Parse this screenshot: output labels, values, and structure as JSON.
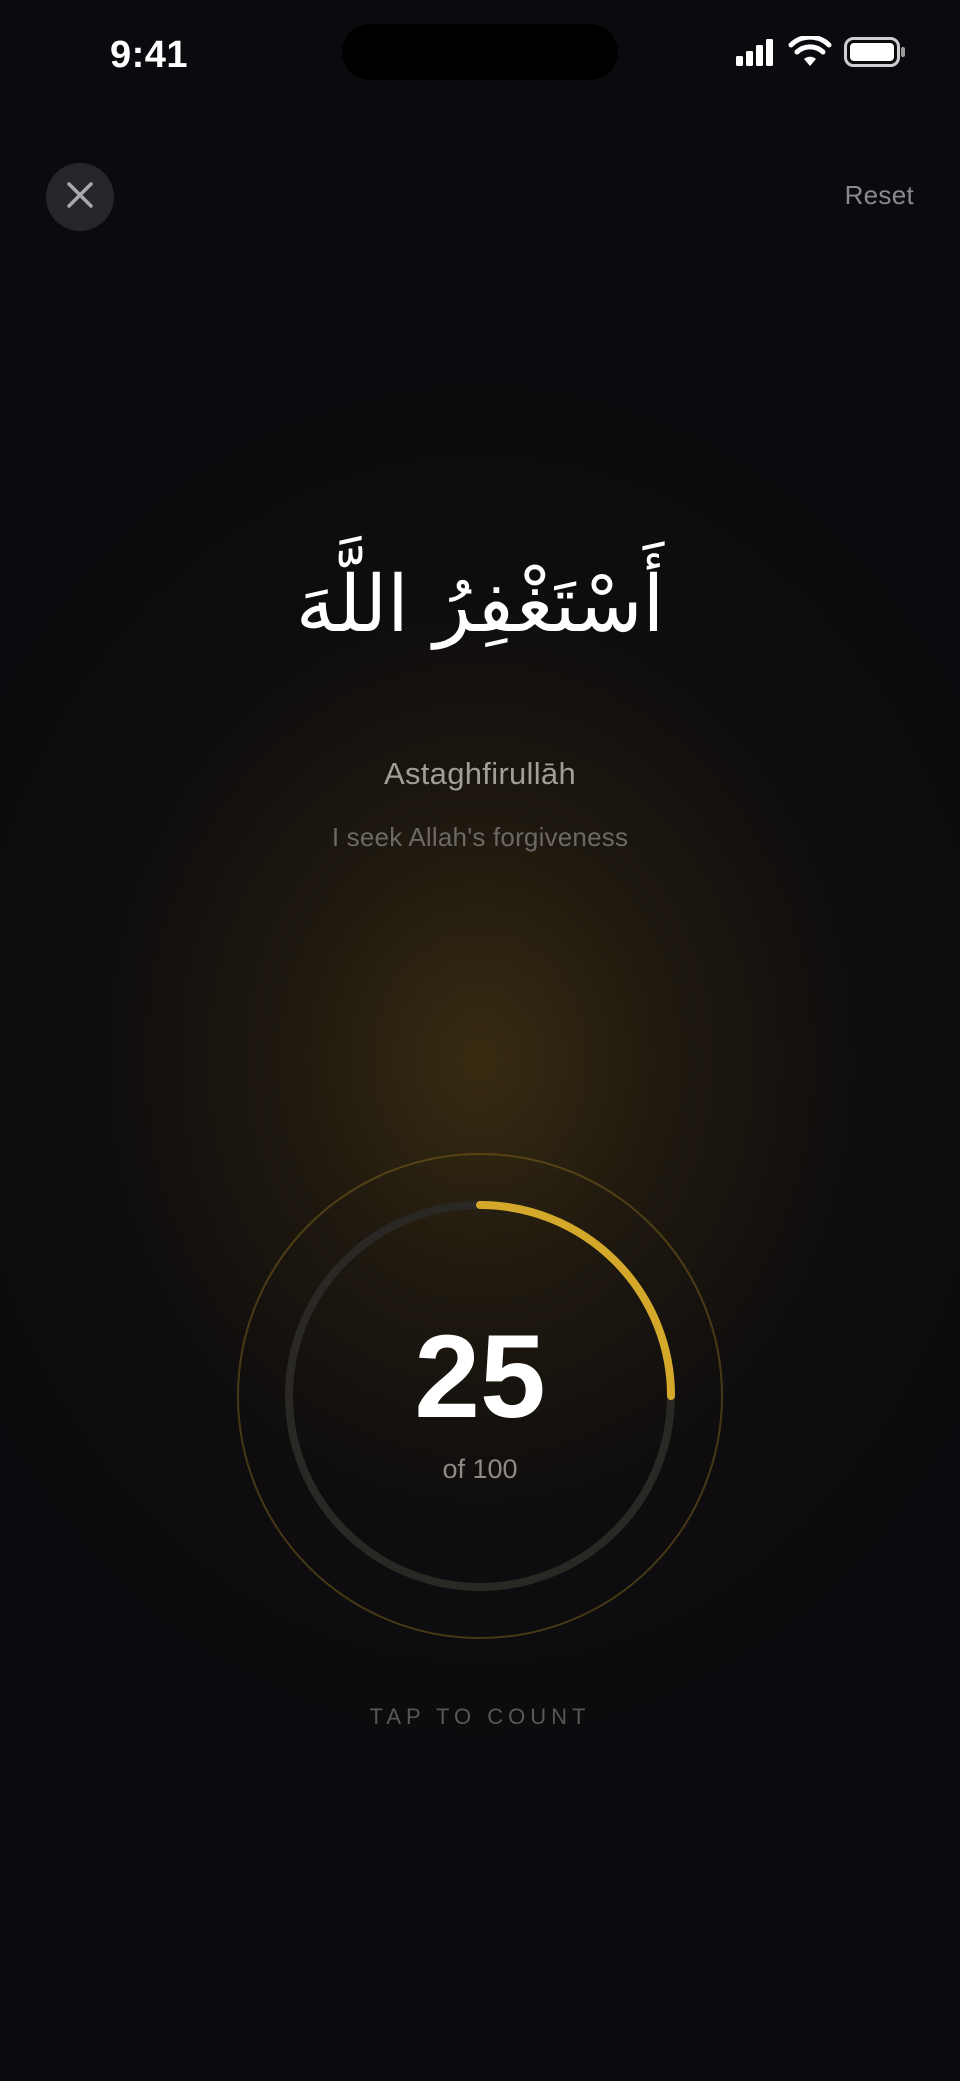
{
  "status_bar": {
    "time": "9:41",
    "icons": [
      "cellular-signal-icon",
      "wifi-icon",
      "battery-icon"
    ]
  },
  "header": {
    "close_icon": "close-icon",
    "reset_label": "Reset"
  },
  "dhikr": {
    "arabic": "أَسْتَغْفِرُ اللَّهَ",
    "transliteration": "Astaghfirullāh",
    "translation": "I seek Allah's forgiveness"
  },
  "counter": {
    "count": "25",
    "total_label": "of 100",
    "progress_fraction": 0.25
  },
  "hint": {
    "label": "TAP TO COUNT"
  },
  "colors": {
    "accent": "#d4a82a",
    "background": "#0b0a0e",
    "track": "#2a2824"
  }
}
